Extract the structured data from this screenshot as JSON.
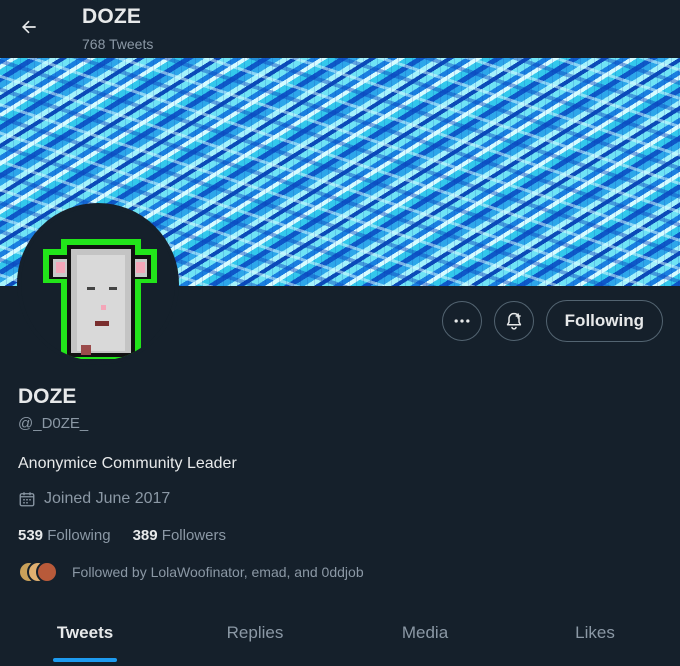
{
  "header": {
    "back_icon": "arrow-left-icon",
    "title": "DOZE",
    "tweet_count": "768 Tweets"
  },
  "profile": {
    "display_name": "DOZE",
    "handle": "@_D0ZE_",
    "bio": "Anonymice Community Leader",
    "joined": "Joined June 2017",
    "following_count": "539",
    "following_label": "Following",
    "followers_count": "389",
    "followers_label": "Followers",
    "followed_by": "Followed by LolaWoofinator, emad, and 0ddjob"
  },
  "actions": {
    "more_icon": "more-icon",
    "notify_icon": "bell-plus-icon",
    "follow_label": "Following"
  },
  "tabs": [
    {
      "label": "Tweets",
      "active": true
    },
    {
      "label": "Replies",
      "active": false
    },
    {
      "label": "Media",
      "active": false
    },
    {
      "label": "Likes",
      "active": false
    }
  ],
  "colors": {
    "background": "#15202b",
    "accent": "#1d9bf0",
    "secondary_text": "#8b98a5",
    "avatar_outline": "#22e51a"
  }
}
